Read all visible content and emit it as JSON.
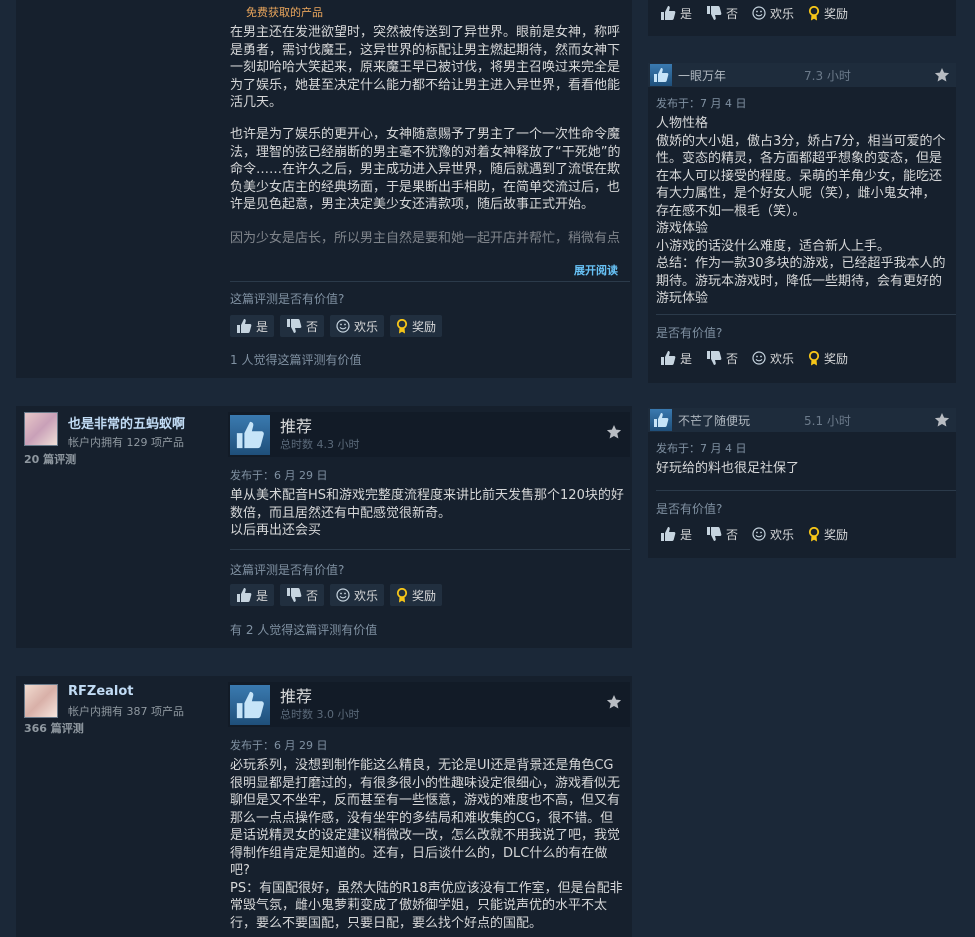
{
  "review1": {
    "free_label": "免费获取的产品",
    "para1": "在男主还在发泄欲望时，突然被传送到了异世界。眼前是女神，称呼是勇者，需讨伐魔王，这异世界的标配让男主燃起期待，然而女神下一刻却哈哈大笑起来，原来魔王早已被讨伐，将男主召唤过来完全是为了娱乐，她甚至决定什么能力都不给让男主进入异世界，看看他能活几天。",
    "para2": "也许是为了娱乐的更开心，女神随意赐予了男主了一个一次性命令魔法，理智的弦已经崩断的男主毫不犹豫的对着女神释放了“干死她”的命令……在许久之后，男主成功进入异世界，随后就遇到了流氓在欺负美少女店主的经典场面，于是果断出手相助，在简单交流过后，也许是见色起意，男主决定美少女还清款项，随后故事正式开始。",
    "para3": "因为少女是店长，所以男主自然是要和她一起开店并帮忙，稍微有点",
    "expand": "展开阅读",
    "helpful_q": "这篇评测是否有价值?",
    "yes": "是",
    "no": "否",
    "funny": "欢乐",
    "award": "奖励",
    "helpful_count": "1 人觉得这篇评测有价值"
  },
  "top_right_votes": {
    "yes": "是",
    "no": "否",
    "funny": "欢乐",
    "award": "奖励"
  },
  "review2": {
    "username": "也是非常的五蚂蚁啊",
    "owned": "帐户内拥有 129 项产品",
    "reviews": "20 篇评测",
    "rec": "推荐",
    "hours": "总时数 4.3 小时",
    "posted": "发布于：6 月 29 日",
    "text": "单从美术配音HS和游戏完整度流程度来讲比前天发售那个120块的好数倍，而且居然还有中配感觉很新奇。\n以后再出还会买",
    "helpful_q": "这篇评测是否有价值?",
    "yes": "是",
    "no": "否",
    "funny": "欢乐",
    "award": "奖励",
    "helpful_count": "有 2 人觉得这篇评测有价值"
  },
  "review3": {
    "username": "RFZealot",
    "owned": "帐户内拥有 387 项产品",
    "reviews": "366 篇评测",
    "rec": "推荐",
    "hours": "总时数 3.0 小时",
    "posted": "发布于：6 月 29 日",
    "text": "必玩系列，没想到制作能这么精良，无论是UI还是背景还是角色CG很明显都是打磨过的，有很多很小的性趣味设定很细心，游戏看似无聊但是又不坐牢，反而甚至有一些惬意，游戏的难度也不高，但又有那么一点点操作感，没有坐牢的多结局和难收集的CG，很不错。但是话说精灵女的设定建议稍微改一改，怎么改就不用我说了吧，我觉得制作组肯定是知道的。还有，日后谈什么的，DLC什么的有在做吧?\nPS：有国配很好，虽然大陆的R18声优应该没有工作室，但是台配非常毁气氛，雌小鬼萝莉变成了傲娇御学姐，只能说声优的水平不太行，要么不要国配，只要日配，要么找个好点的国配。"
  },
  "side1": {
    "name": "一眼万年",
    "hours": "7.3 小时",
    "posted": "发布于：7 月 4 日",
    "text": "人物性格\n傲娇的大小姐，傲占3分，娇占7分，相当可爱的个性。变态的精灵，各方面都超乎想象的变态，但是在本人可以接受的程度。呆萌的羊角少女，能吃还有大力属性，是个好女人呢（笑），雌小鬼女神，存在感不如一根毛（笑）。\n游戏体验\n小游戏的话没什么难度，适合新人上手。\n总结：作为一款30多块的游戏，已经超乎我本人的期待。游玩本游戏时，降低一些期待，会有更好的游玩体验",
    "helpful_q": "是否有价值?",
    "yes": "是",
    "no": "否",
    "funny": "欢乐",
    "award": "奖励"
  },
  "side2": {
    "name": "不芒了随便玩",
    "hours": "5.1 小时",
    "posted": "发布于：7 月 4 日",
    "text": "好玩给的料也很足社保了",
    "helpful_q": "是否有价值?",
    "yes": "是",
    "no": "否",
    "funny": "欢乐",
    "award": "奖励"
  },
  "colors": {
    "background": "#1b2838",
    "panel": "#16202d",
    "link_blue": "#67c1f5",
    "username": "#c1dbf4",
    "free_orange": "#e9a55c",
    "award_yellow": "#f5c518"
  },
  "icons": [
    "thumbs-up-icon",
    "thumbs-down-icon",
    "smiley-icon",
    "award-icon",
    "star-icon"
  ]
}
